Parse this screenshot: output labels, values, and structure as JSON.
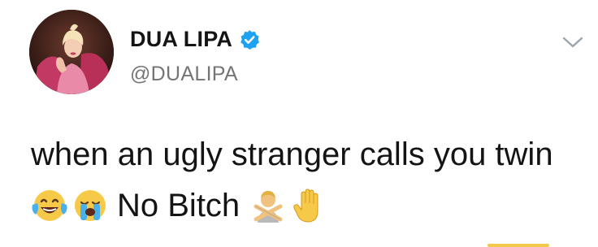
{
  "tweet": {
    "display_name": "DUA LIPA",
    "handle": "@DUALIPA",
    "text_line1": "when an ugly stranger calls you twin",
    "text_line2": "No Bitch",
    "emojis_before": [
      "face-with-tears-of-joy",
      "loudly-crying-face"
    ],
    "emojis_after": [
      "person-gesturing-no",
      "raised-hand"
    ]
  },
  "icons": {
    "verified": "verified-badge-icon",
    "menu": "chevron-down-icon"
  },
  "colors": {
    "verified_blue": "#1da1f2",
    "text": "#141414",
    "handle": "#757575",
    "background": "#ffffff"
  }
}
